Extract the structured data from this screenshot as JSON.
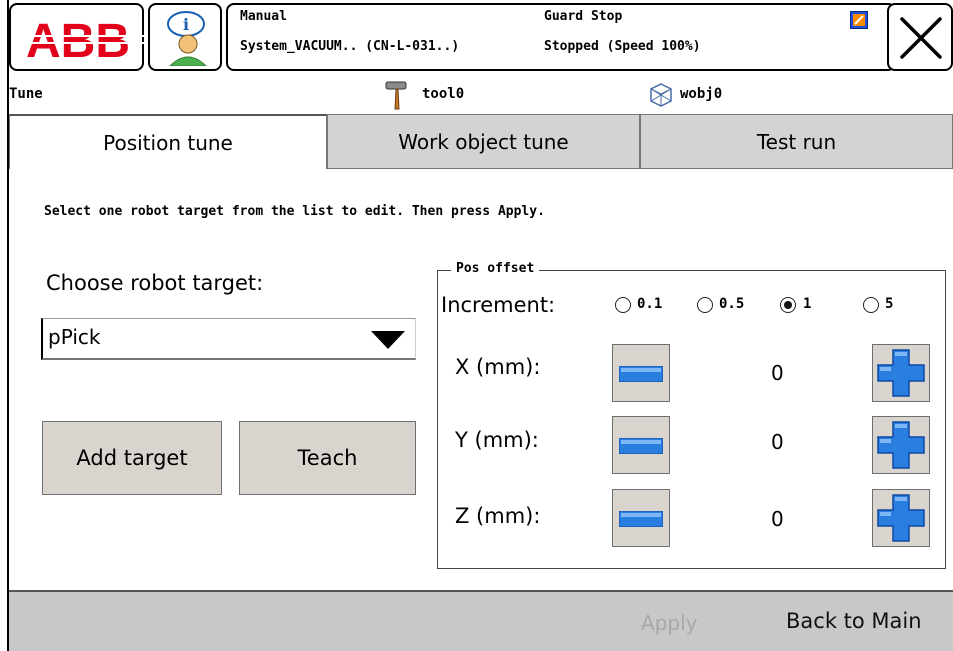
{
  "header": {
    "brand": "ABB",
    "mode": "Manual",
    "system": "System_VACUUM.. (CN-L-031..)",
    "safety_state": "Guard Stop",
    "run_state": "Stopped (Speed 100%)"
  },
  "infobar": {
    "app_name": "Tune",
    "tool": "tool0",
    "wobj": "wobj0"
  },
  "tabs": [
    {
      "label": "Position tune",
      "active": true
    },
    {
      "label": "Work object  tune",
      "active": false
    },
    {
      "label": "Test run",
      "active": false
    }
  ],
  "main": {
    "instruction": "Select one robot target from the list to edit. Then press Apply.",
    "choose_label": "Choose robot target:",
    "target_selected": "pPick",
    "add_target_label": "Add target",
    "teach_label": "Teach"
  },
  "pos_offset": {
    "title": "Pos offset",
    "increment_label": "Increment:",
    "increments": [
      {
        "label": "0.1",
        "selected": false
      },
      {
        "label": "0.5",
        "selected": false
      },
      {
        "label": "1",
        "selected": true
      },
      {
        "label": "5",
        "selected": false
      }
    ],
    "rows": [
      {
        "label": "X (mm):",
        "value": "0"
      },
      {
        "label": "Y (mm):",
        "value": "0"
      },
      {
        "label": "Z (mm):",
        "value": "0"
      }
    ]
  },
  "footer": {
    "apply_label": "Apply",
    "back_label": "Back to Main"
  },
  "colors": {
    "abb_red": "#e2001a",
    "button_face": "#d9d5ce",
    "icon_blue": "#1e78e6"
  }
}
